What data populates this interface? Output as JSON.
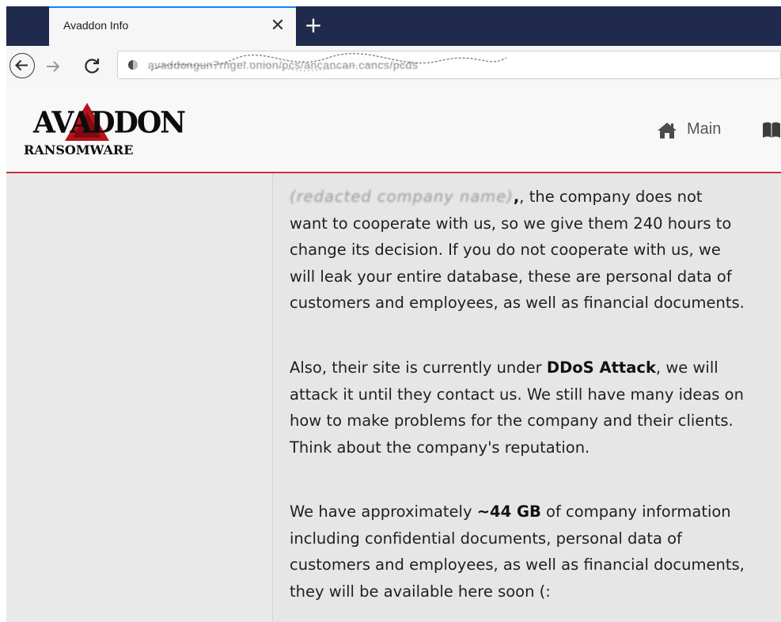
{
  "browser": {
    "tab_title": "Avaddon Info",
    "close_glyph": "✕",
    "new_tab_glyph": "+",
    "url_text": "avaddongun7rngel.onion/pcs/ancancan.cancs/pcds"
  },
  "header": {
    "logo_top": "AVADDON",
    "logo_bottom": "RANSOMWARE",
    "nav_main_label": "Main",
    "icons": [
      "home-icon",
      "book-icon"
    ],
    "accent_color": "#c9303a"
  },
  "article": {
    "p1": {
      "redacted": "(redacted company name)",
      "line1_tail": ", the company does not",
      "line2": "want to cooperate with us, so we give them 240 hours to",
      "line3": "change its decision. If you do not cooperate with us, we",
      "line4": "will leak your entire database, these are personal data of",
      "line5": "customers and employees, as well as financial documents."
    },
    "p2": {
      "line1_a": "Also, their site is currently under ",
      "line1_bold": "DDoS Attack",
      "line1_b": ", we will",
      "line2": "attack it until they contact us. We still have many ideas on",
      "line3": "how to make problems for the company and their clients.",
      "line4": "Think about the company's reputation."
    },
    "p3": {
      "line1_a": "We have approximately ",
      "line1_bold": "~44 GB",
      "line1_b": " of company information",
      "line2": "including confidential documents, personal data of",
      "line3": "customers and employees, as well as financial documents,",
      "line4": "they will be available here soon (:"
    }
  }
}
